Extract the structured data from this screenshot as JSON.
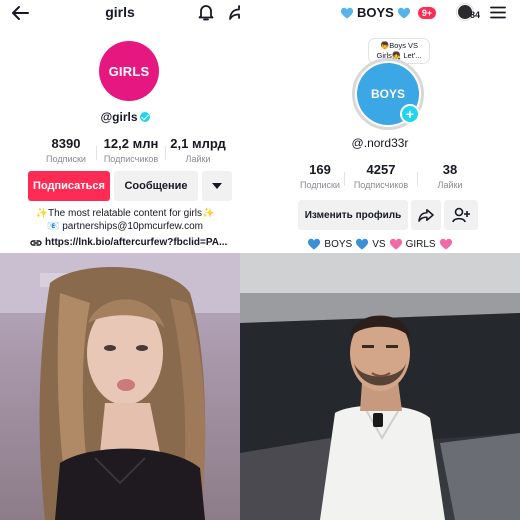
{
  "left_profile": {
    "title": "girls",
    "avatar_text": "GIRLS",
    "handle": "@girls",
    "stats": [
      {
        "value": "8390",
        "label": "Подписки"
      },
      {
        "value": "12,2 млн",
        "label": "Подписчиков"
      },
      {
        "value": "2,1 млрд",
        "label": "Лайки"
      }
    ],
    "subscribe_label": "Подписаться",
    "message_label": "Сообщение",
    "bio_line1": "✨The most relatable content for girls✨",
    "bio_line2": "📧 partnerships@10pmcurfew.com",
    "link": "https://lnk.bio/aftercurfew?fbclid=PA..."
  },
  "right_profile": {
    "title": "BOYS",
    "notif_count": "9+",
    "story_count": "84",
    "bubble_line1": "👦Boys VS",
    "bubble_line2": "Girls👧 Let'...",
    "avatar_text": "BOYS",
    "handle": "@.nord33r",
    "stats": [
      {
        "value": "169",
        "label": "Подписки"
      },
      {
        "value": "4257",
        "label": "Подписчиков"
      },
      {
        "value": "38",
        "label": "Лайки"
      }
    ],
    "edit_label": "Изменить профиль",
    "boys_word": "BOYS",
    "vs_word": "VS",
    "girls_word": "GIRLS"
  },
  "colors": {
    "accent_red": "#fe2c55",
    "girls_pink": "#e6177f",
    "boys_blue": "#3ba7e4",
    "verified_cyan": "#20d5ec"
  }
}
